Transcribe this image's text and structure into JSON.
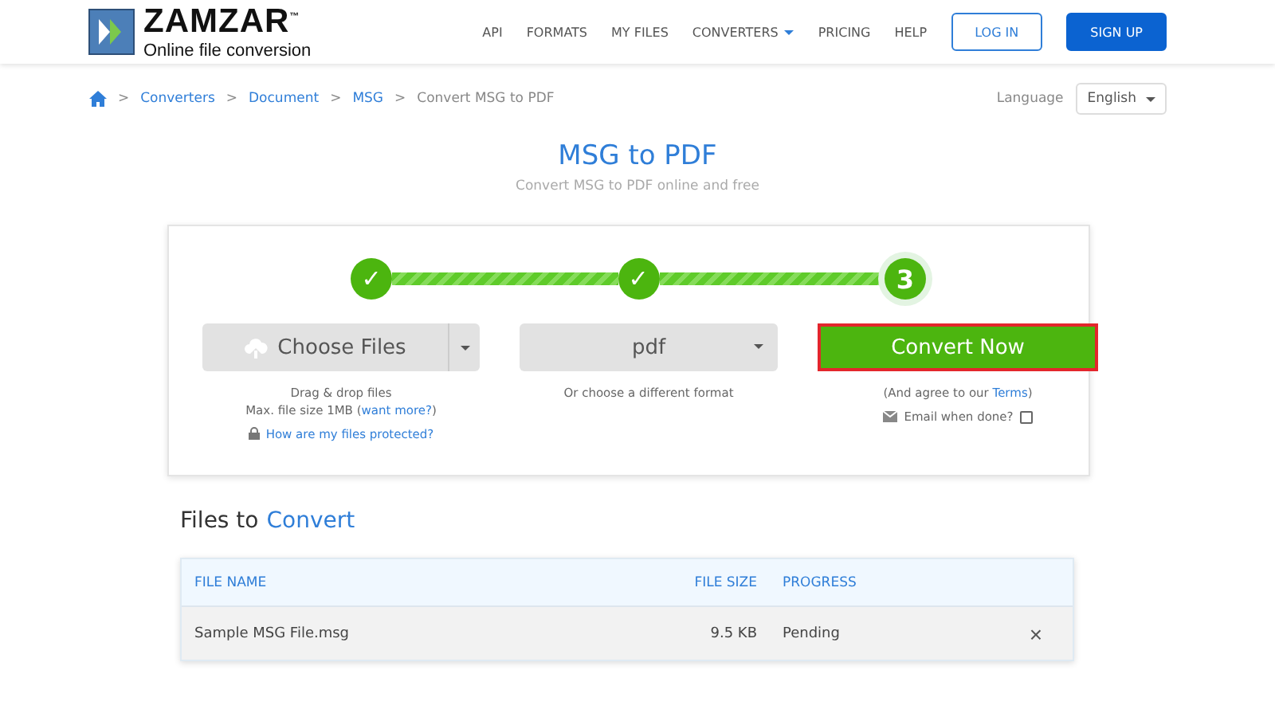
{
  "header": {
    "logo": {
      "name": "ZAMZAR",
      "trademark": "™",
      "tagline": "Online file conversion"
    },
    "nav": [
      {
        "label": "API",
        "kind": "link"
      },
      {
        "label": "FORMATS",
        "kind": "link"
      },
      {
        "label": "MY FILES",
        "kind": "link"
      },
      {
        "label": "CONVERTERS",
        "kind": "dropdown"
      },
      {
        "label": "PRICING",
        "kind": "link"
      },
      {
        "label": "HELP",
        "kind": "link"
      }
    ],
    "login": "LOG IN",
    "signup": "SIGN UP"
  },
  "breadcrumb": {
    "items": [
      "Converters",
      "Document",
      "MSG"
    ],
    "current": "Convert MSG to PDF",
    "separator": ">"
  },
  "language": {
    "label": "Language",
    "value": "English"
  },
  "title": "MSG to PDF",
  "subtitle": "Convert MSG to PDF online and free",
  "connectors": [
    {
      "level": 1
    },
    {
      "level": 1
    }
  ],
  "steps": [
    {
      "kind": "done",
      "label": "✓"
    },
    {
      "kind": "done",
      "label": "✓"
    },
    {
      "kind": "current",
      "label": "3"
    }
  ],
  "choose": {
    "label": "Choose Files",
    "hint1": "Drag & drop files",
    "hint2": "Max. file size 1MB (",
    "hint2_link": "want more?",
    "hint2_end": ")",
    "protect": "How are my files protected?"
  },
  "format": {
    "value": "pdf",
    "hint": "Or choose a different format"
  },
  "convert": {
    "label": "Convert Now",
    "focused": true,
    "terms_pre": "(And agree to our ",
    "terms_link": "Terms",
    "terms_post": ")",
    "email": "Email when done?",
    "email_checked": false
  },
  "files_title": {
    "plain": "Files to",
    "accent": "Convert"
  },
  "table": {
    "columns": [
      "FILE NAME",
      "FILE SIZE",
      "PROGRESS"
    ],
    "rows": [
      {
        "name": "Sample MSG File.msg",
        "size": "9.5 KB",
        "progress": "Pending",
        "remove": "×"
      }
    ]
  }
}
